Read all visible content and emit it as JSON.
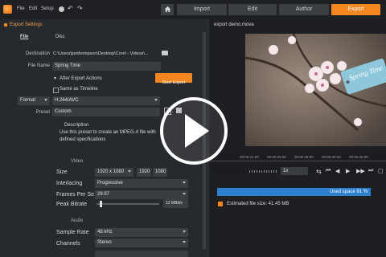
{
  "menu": {
    "file": "File",
    "edit": "Edit",
    "setup": "Setup"
  },
  "nav": {
    "import": "Import",
    "edit": "Edit",
    "author": "Author",
    "export": "Export"
  },
  "colors": {
    "accent": "#f5861f",
    "used_space": "#2f7fcf",
    "background": "#2a2d31"
  },
  "export_settings": {
    "title": "Export Settings",
    "tabs": [
      "File",
      "Disc"
    ],
    "destination_label": "Destination",
    "destination_value": "C:\\Users\\jonthompson\\Desktop\\Corel - Videos\\...",
    "file_name_label": "File Name",
    "file_name_value": "Spring Time",
    "after_export_label": "After Export Actions",
    "start_export": "Start Export",
    "same_as_timeline": "Same as Timeline",
    "format_label": "Format",
    "format_value": "H.264/AVC",
    "preset_label": "Preset",
    "preset_value": "Custom",
    "description_label": "Description",
    "description_text_1": "Use this preset to create an MPEG-4 file with",
    "description_text_2": "defined specifications"
  },
  "video": {
    "section": "Video",
    "size_label": "Size",
    "size_value": "1920 x 1080",
    "width": "1920",
    "height": "1080",
    "interlacing_label": "Interlacing",
    "interlacing_value": "Progressive",
    "fps_label": "Frames Per Se...",
    "fps_value": "29.97",
    "bitrate_label": "Peak Bitrate",
    "bitrate_value": "12 MBit/s",
    "bitrate_level": 0.05
  },
  "audio": {
    "section": "Audio",
    "sample_rate_label": "Sample Rate",
    "sample_rate_value": "48 kHz",
    "channels_label": "Channels",
    "channels_value": "Stereo"
  },
  "preview": {
    "filename": "export demo.mova",
    "sign_text": "Spring Time",
    "timecodes": [
      "00:00:24:00",
      "00:00:26:00",
      "00:00:28:00",
      "00:00:30:00",
      "00:00:32:00"
    ],
    "speed": "1x",
    "used_space": "Used space 91 %",
    "used_space_fraction": 0.91,
    "estimated_size": "Estimated file size: 41.45 MB"
  }
}
